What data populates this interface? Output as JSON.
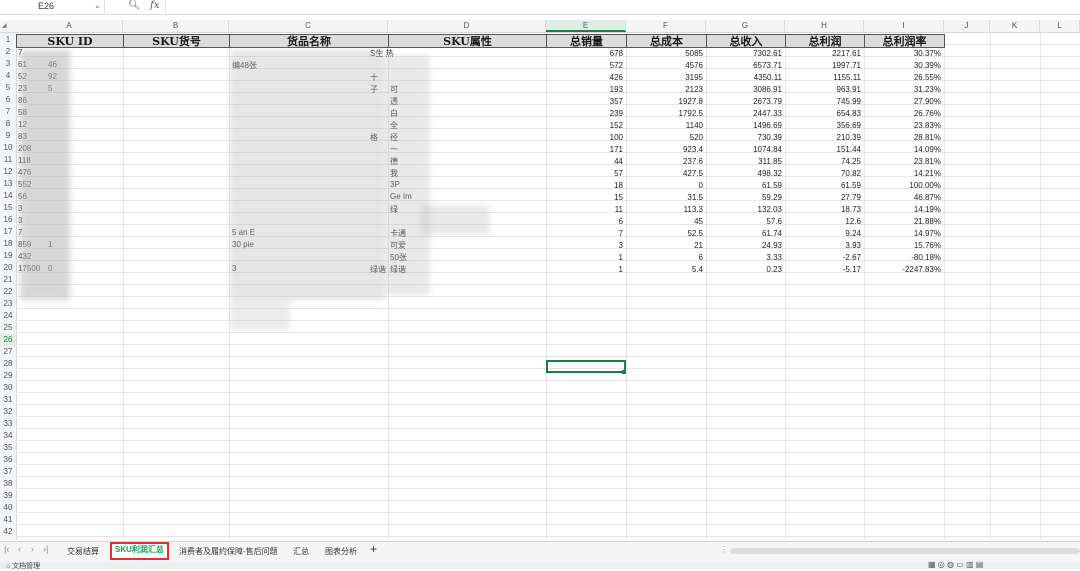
{
  "formula_bar": {
    "cell_ref": "E26",
    "fx_label": "fx"
  },
  "columns": [
    "A",
    "B",
    "C",
    "D",
    "E",
    "F",
    "G",
    "H",
    "I",
    "J",
    "K",
    "L"
  ],
  "rows": [
    "1",
    "2",
    "3",
    "4",
    "5",
    "6",
    "7",
    "8",
    "9",
    "10",
    "11",
    "12",
    "13",
    "14",
    "15",
    "16",
    "17",
    "18",
    "19",
    "20",
    "21",
    "22",
    "23",
    "24",
    "25",
    "26",
    "27",
    "28",
    "29",
    "30",
    "31",
    "32",
    "33",
    "34",
    "35",
    "36",
    "37",
    "38",
    "39",
    "40",
    "41",
    "42"
  ],
  "table": {
    "headers": [
      "SKU ID",
      "SKU货号",
      "货品名称",
      "SKU属性",
      "总销量",
      "总成本",
      "总收入",
      "总利润",
      "总利润率"
    ],
    "data": [
      [
        "678",
        "5085",
        "7302.61",
        "2217.61",
        "30.37%"
      ],
      [
        "572",
        "4576",
        "6573.71",
        "1997.71",
        "30.39%"
      ],
      [
        "426",
        "3195",
        "4350.11",
        "1155.11",
        "26.55%"
      ],
      [
        "193",
        "2123",
        "3086.91",
        "963.91",
        "31.23%"
      ],
      [
        "357",
        "1927.8",
        "2673.79",
        "745.99",
        "27.90%"
      ],
      [
        "239",
        "1792.5",
        "2447.33",
        "654.83",
        "26.76%"
      ],
      [
        "152",
        "1140",
        "1496.69",
        "356.69",
        "23.83%"
      ],
      [
        "100",
        "520",
        "730.39",
        "210.39",
        "28.81%"
      ],
      [
        "171",
        "923.4",
        "1074.84",
        "151.44",
        "14.09%"
      ],
      [
        "44",
        "237.6",
        "311.85",
        "74.25",
        "23.81%"
      ],
      [
        "57",
        "427.5",
        "498.32",
        "70.82",
        "14.21%"
      ],
      [
        "18",
        "0",
        "61.59",
        "61.59",
        "100.00%"
      ],
      [
        "15",
        "31.5",
        "59.29",
        "27.79",
        "46.87%"
      ],
      [
        "11",
        "113.3",
        "132.03",
        "18.73",
        "14.19%"
      ],
      [
        "6",
        "45",
        "57.6",
        "12.6",
        "21.88%"
      ],
      [
        "7",
        "52.5",
        "61.74",
        "9.24",
        "14.97%"
      ],
      [
        "3",
        "21",
        "24.93",
        "3.93",
        "15.76%"
      ],
      [
        "1",
        "6",
        "3.33",
        "-2.67",
        "-80.18%"
      ],
      [
        "1",
        "5.4",
        "0.23",
        "-5.17",
        "-2247.83%"
      ]
    ],
    "sku_fragments": [
      "7",
      "61",
      "52",
      "23",
      "86",
      "58",
      "12",
      "83",
      "208",
      "118",
      "476",
      "552",
      "56",
      "3",
      "3",
      "7",
      "859",
      "432",
      "17500"
    ],
    "sku_fragments_b": [
      "",
      "46",
      "92",
      "5",
      "",
      "",
      "",
      "",
      "",
      "",
      "",
      "",
      "",
      "",
      "",
      "",
      "1",
      "",
      "0"
    ],
    "name_fragments": [
      "",
      "编48张",
      "",
      "",
      "",
      "",
      "",
      "",
      "",
      "",
      "",
      "",
      "",
      "",
      "",
      "5    an E",
      "30 pie",
      "",
      "3"
    ],
    "attr_fragments": [
      "S生  热",
      "",
      "十",
      "子",
      "",
      "",
      "",
      "格",
      "",
      "",
      "",
      "",
      "",
      "",
      "",
      "",
      "",
      "",
      "绿谐"
    ],
    "attr_d_fragments": [
      "",
      "",
      "",
      "可",
      "透",
      "白",
      "全",
      "径",
      "一",
      "德",
      "我",
      "3P",
      "Ge     Im",
      "绿",
      "",
      "卡通",
      "可爱",
      "50张",
      "绿谐"
    ]
  },
  "sheet_tabs": {
    "items": [
      "交易结算",
      "SKU利润汇总",
      "消费者及履约保障-售后问题",
      "汇总",
      "图表分析"
    ],
    "active_index": 1,
    "add_label": "+"
  },
  "status_bar": {
    "left_text": "⌂ 文档管理"
  },
  "colors": {
    "accent": "#1f7a4c",
    "active_tab_border": "#e0322d",
    "active_tab_text": "#1f9d55",
    "header_fill": "#dcdcdc"
  }
}
